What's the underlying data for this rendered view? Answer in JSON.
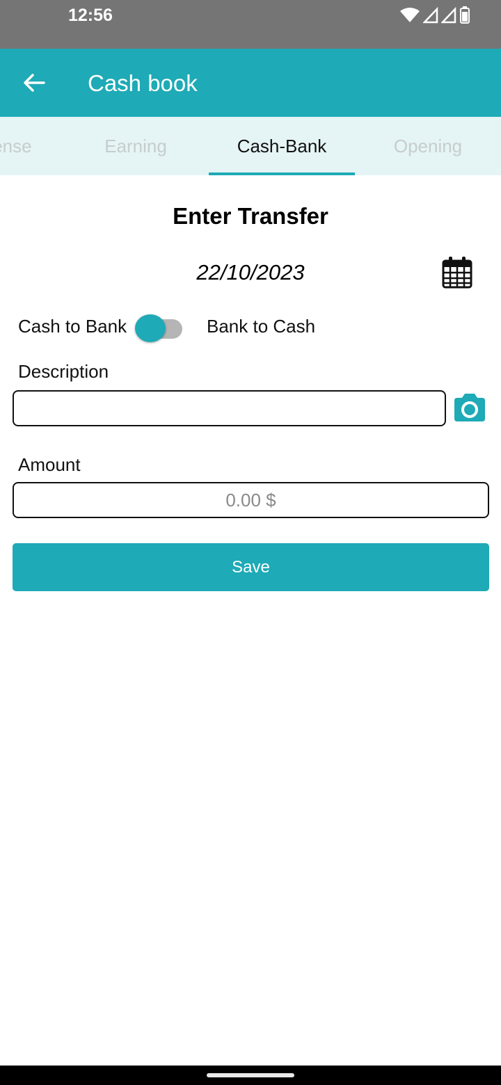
{
  "status_bar": {
    "time": "12:56",
    "icons": [
      "wifi-icon",
      "signal-icon",
      "signal-icon",
      "battery-icon"
    ]
  },
  "app_bar": {
    "title": "Cash book",
    "back_icon": "arrow-back-icon"
  },
  "tabs": [
    {
      "label": "Expense",
      "active": false
    },
    {
      "label": "Earning",
      "active": false
    },
    {
      "label": "Cash-Bank",
      "active": true
    },
    {
      "label": "Opening",
      "active": false
    }
  ],
  "form": {
    "title": "Enter Transfer",
    "date": "22/10/2023",
    "calendar_icon": "calendar-icon",
    "direction_left_label": "Cash to Bank",
    "direction_right_label": "Bank to Cash",
    "description_label": "Description",
    "description_value": "",
    "camera_icon": "camera-icon",
    "amount_label": "Amount",
    "amount_placeholder": "0.00 $",
    "save_label": "Save"
  },
  "colors": {
    "accent": "#1eaab6",
    "status_bar": "#757575",
    "tab_strip": "#e5f4f5"
  }
}
